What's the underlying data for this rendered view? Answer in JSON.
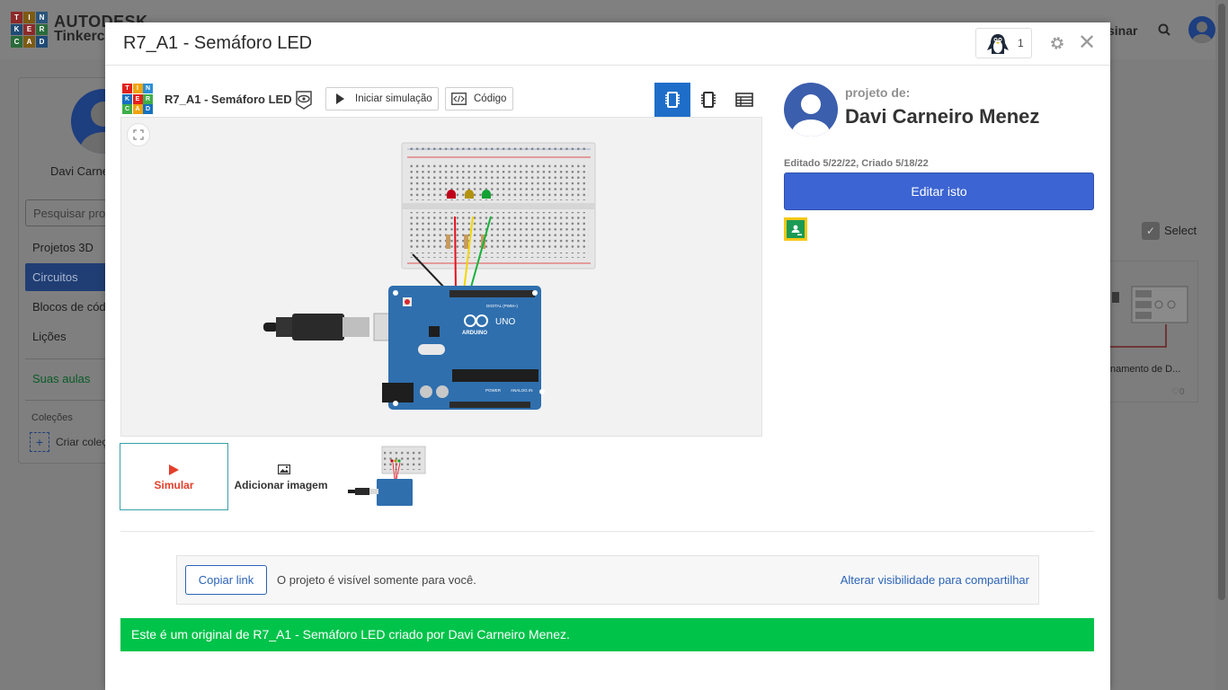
{
  "background": {
    "logo_letters": [
      "T",
      "I",
      "N",
      "K",
      "E",
      "R",
      "C",
      "A",
      "D"
    ],
    "brand_line1": "AUTODESK",
    "brand_line2": "Tinkercad",
    "assinar": "sinar",
    "user_name": "Davi Carne",
    "search_placeholder": "Pesquisar pro",
    "nav": [
      "Projetos 3D",
      "Circuitos",
      "Blocos de cód",
      "Lições"
    ],
    "suas_aulas": "Suas aulas",
    "colecoes": "Coleções",
    "criar_colecao": "Criar coleç",
    "select_label": "Select",
    "card_name": "namento de D...",
    "card_likes": "0"
  },
  "modal": {
    "title": "R7_A1 - Semáforo LED",
    "collaborators": "1"
  },
  "editor": {
    "logo_letters": [
      "T",
      "I",
      "N",
      "K",
      "E",
      "R",
      "C",
      "A",
      "D"
    ],
    "project_name": "R7_A1 - Semáforo LED",
    "start_sim": "Iniciar simulação",
    "code": "Código"
  },
  "thumbs": {
    "simulate": "Simular",
    "add_image": "Adicionar imagem"
  },
  "owner": {
    "label": "projeto de:",
    "name": "Davi Carneiro Menez",
    "dates": "Editado 5/22/22, Criado 5/18/22",
    "edit_button": "Editar isto"
  },
  "share": {
    "copy_link": "Copiar link",
    "visibility": "O projeto é visível somente para você.",
    "change_visibility": "Alterar visibilidade para compartilhar"
  },
  "banner": "Este é um original de R7_A1 - Semáforo LED criado por Davi Carneiro Menez.",
  "colors": {
    "primary": "#3c64d2",
    "banner": "#00c34a",
    "simulate": "#e43f2b",
    "active_view": "#1e6ec9"
  }
}
